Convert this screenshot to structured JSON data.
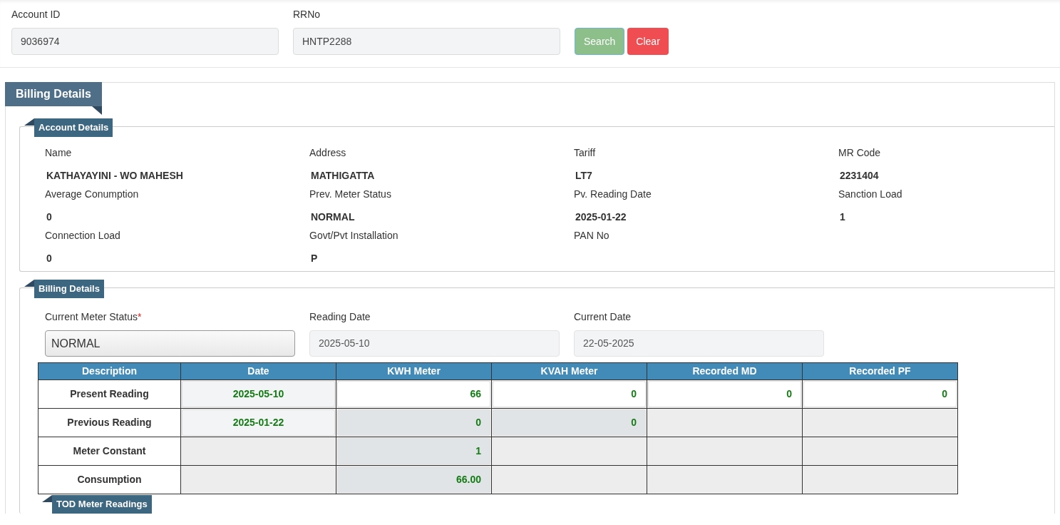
{
  "search": {
    "fields": [
      {
        "label": "Account ID",
        "value": "9036974"
      },
      {
        "label": "RRNo",
        "value": "HNTP2288"
      }
    ],
    "buttons": [
      {
        "label": "Search",
        "kind": "search"
      },
      {
        "label": "Clear",
        "kind": "clear"
      }
    ]
  },
  "panel_title": "Billing Details",
  "account_details": {
    "title": "Account Details",
    "fields": [
      {
        "label": "Name",
        "value": "KATHAYAYINI - WO MAHESH"
      },
      {
        "label": "Address",
        "value": "MATHIGATTA"
      },
      {
        "label": "Tariff",
        "value": "LT7"
      },
      {
        "label": "MR Code",
        "value": "2231404"
      },
      {
        "label": "Average Conumption",
        "value": "0"
      },
      {
        "label": "Prev. Meter Status",
        "value": "NORMAL"
      },
      {
        "label": "Pv. Reading Date",
        "value": "2025-01-22"
      },
      {
        "label": "Sanction Load",
        "value": "1"
      },
      {
        "label": "Connection Load",
        "value": "0"
      },
      {
        "label": "Govt/Pvt Installation",
        "value": "P"
      },
      {
        "label": "PAN No"
      }
    ]
  },
  "billing_details": {
    "title": "Billing Details",
    "required_mark": "*",
    "fields": [
      {
        "label": "Current Meter Status",
        "required": true,
        "kind": "select",
        "value": "NORMAL"
      },
      {
        "label": "Reading Date",
        "required": false,
        "kind": "readonly",
        "value": "2025-05-10"
      },
      {
        "label": "Current Date",
        "required": false,
        "kind": "readonly",
        "value": "22-05-2025"
      }
    ],
    "table": {
      "columns": [
        "Description",
        "Date",
        "KWH Meter",
        "KVAH Meter",
        "Recorded MD",
        "Recorded PF"
      ],
      "rows": [
        {
          "cells": [
            {
              "kind": "label",
              "value": "Present Reading"
            },
            {
              "kind": "readonly",
              "value": "2025-05-10"
            },
            {
              "kind": "input",
              "value": "66"
            },
            {
              "kind": "input",
              "value": "0"
            },
            {
              "kind": "input",
              "value": "0"
            },
            {
              "kind": "input",
              "value": "0"
            }
          ]
        },
        {
          "cells": [
            {
              "kind": "label",
              "value": "Previous Reading"
            },
            {
              "kind": "readonly",
              "value": "2025-01-22"
            },
            {
              "kind": "readonly",
              "value": "0"
            },
            {
              "kind": "readonly",
              "value": "0"
            },
            {
              "kind": "empty"
            },
            {
              "kind": "empty"
            }
          ]
        },
        {
          "cells": [
            {
              "kind": "label",
              "value": "Meter Constant"
            },
            {
              "kind": "empty"
            },
            {
              "kind": "readonly",
              "value": "1"
            },
            {
              "kind": "empty"
            },
            {
              "kind": "empty"
            },
            {
              "kind": "empty"
            }
          ]
        },
        {
          "cells": [
            {
              "kind": "label",
              "value": "Consumption"
            },
            {
              "kind": "empty"
            },
            {
              "kind": "readonly",
              "value": "66.00"
            },
            {
              "kind": "empty"
            },
            {
              "kind": "empty"
            },
            {
              "kind": "empty"
            }
          ]
        }
      ]
    }
  },
  "tod_title": "TOD Meter Readings"
}
